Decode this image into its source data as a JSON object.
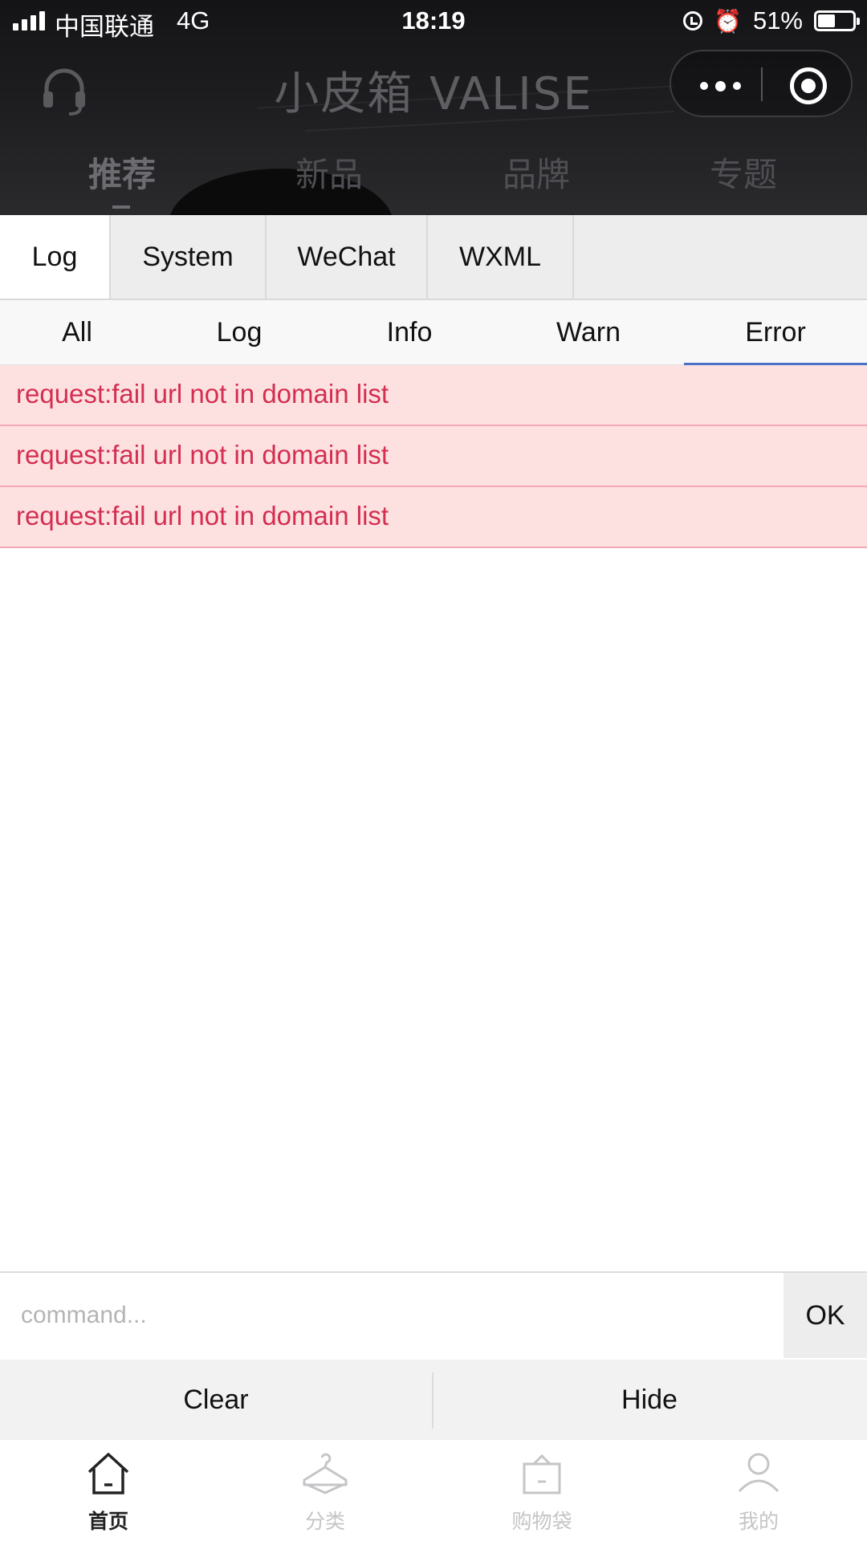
{
  "status_bar": {
    "carrier": "中国联通",
    "network": "4G",
    "time": "18:19",
    "battery": "51%",
    "battery_level": 0.51
  },
  "header": {
    "brand": "小皮箱 VALISE",
    "icons": [
      "headset-icon",
      "more-dots-icon",
      "record-icon"
    ]
  },
  "category_tabs": [
    {
      "label": "推荐",
      "active": true
    },
    {
      "label": "新品",
      "active": false
    },
    {
      "label": "品牌",
      "active": false
    },
    {
      "label": "专题",
      "active": false
    }
  ],
  "console": {
    "main_tabs": [
      {
        "label": "Log",
        "active": true
      },
      {
        "label": "System",
        "active": false
      },
      {
        "label": "WeChat",
        "active": false
      },
      {
        "label": "WXML",
        "active": false
      }
    ],
    "filter_tabs": [
      {
        "label": "All",
        "active": false
      },
      {
        "label": "Log",
        "active": false
      },
      {
        "label": "Info",
        "active": false
      },
      {
        "label": "Warn",
        "active": false
      },
      {
        "label": "Error",
        "active": true
      }
    ],
    "logs": [
      {
        "level": "error",
        "text": "request:fail url not in domain list"
      },
      {
        "level": "error",
        "text": "request:fail url not in domain list"
      },
      {
        "level": "error",
        "text": "request:fail url not in domain list"
      }
    ],
    "command": {
      "value": "",
      "placeholder": "command...",
      "submit_label": "OK"
    },
    "actions": {
      "clear_label": "Clear",
      "hide_label": "Hide"
    }
  },
  "tab_bar": [
    {
      "label": "首页",
      "icon": "home-icon",
      "active": true
    },
    {
      "label": "分类",
      "icon": "hanger-icon",
      "active": false
    },
    {
      "label": "购物袋",
      "icon": "shopping-bag-icon",
      "active": false
    },
    {
      "label": "我的",
      "icon": "profile-icon",
      "active": false
    }
  ],
  "colors": {
    "error_text": "#d42e50",
    "error_bg": "#fde1e1",
    "active_underline": "#4b72c7",
    "header_bg": "#1d1d20"
  }
}
